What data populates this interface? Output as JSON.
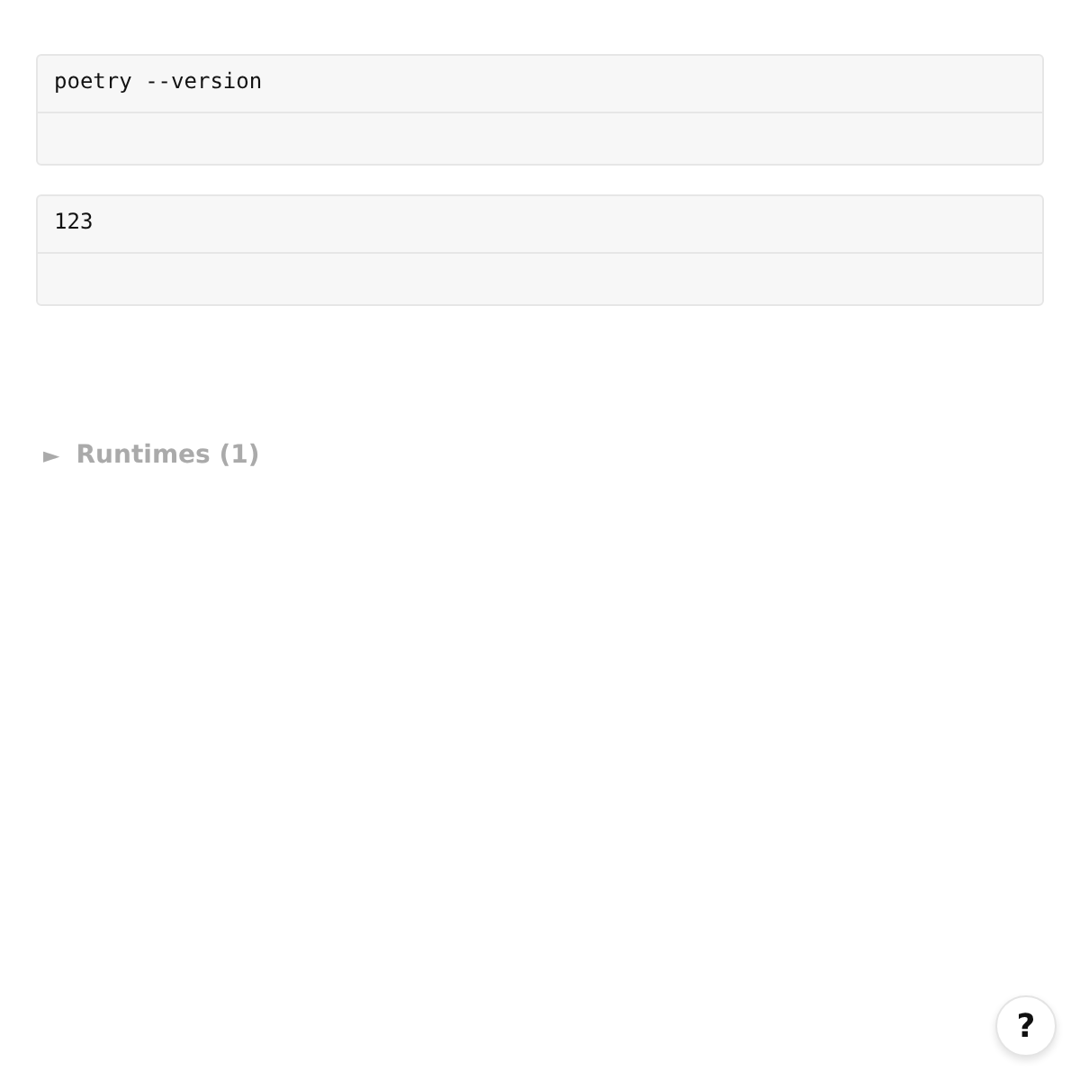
{
  "cells": [
    {
      "code": "poetry --version"
    },
    {
      "code": "123"
    }
  ],
  "runtimes": {
    "arrow": "►",
    "label": "Runtimes (1)",
    "expanded": false
  },
  "help": {
    "label": "?"
  }
}
